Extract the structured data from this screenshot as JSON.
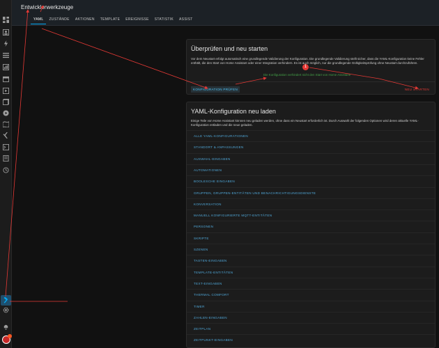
{
  "header": {
    "title": "Entwicklerwerkzeuge",
    "tabs": [
      {
        "label": "YAML",
        "active": true
      },
      {
        "label": "ZUSTÄNDE"
      },
      {
        "label": "AKTIONEN"
      },
      {
        "label": "TEMPLATE"
      },
      {
        "label": "EREIGNISSE"
      },
      {
        "label": "STATISTIK"
      },
      {
        "label": "ASSIST"
      }
    ]
  },
  "check_card": {
    "title": "Überprüfen und neu starten",
    "description": "Vor dem Neustart erfolgt automatisch eine grundlegende Validierung der Konfiguration. Die grundlegende Validierung stellt sicher, dass die YAML-Konfiguration keine Fehler enthält, die den Start von Home Assistant oder einer Integration verhindern. Es ist auch möglich, nur die grundlegende Gültigkeitsprüfung ohne Neustart durchzuführen.",
    "valid_message": "Die Konfiguration verhindert nicht den Start von Home Assistant!",
    "check_button": "KONFIGURATION PRÜFEN",
    "restart_button": "NEU STARTEN"
  },
  "annotation": {
    "marker": "1"
  },
  "reload_card": {
    "title": "YAML-Konfiguration neu laden",
    "description": "Einige Teile von Home Assistant können neu geladen werden, ohne dass ein Neustart erforderlich ist. Durch Auswahl der folgenden Optionen wird deren aktuelle YAML-Konfiguration entladen und die neue geladen.",
    "items": [
      "ALLE YAML-KONFIGURATIONEN",
      "STANDORT & ANPASSUNGEN",
      "AUSWAHL-EINGABEN",
      "AUTOMATIONEN",
      "BOOLESCHE EINGABEN",
      "GRUPPEN, GRUPPEN-ENTITÄTEN UND BENACHRICHTIGUNGSDIENSTE",
      "KONVERSATION",
      "MANUELL KONFIGURIERTE MQTT-ENTITÄTEN",
      "PERSONEN",
      "SKRIPTE",
      "SZENEN",
      "TASTEN-EINGABEN",
      "TEMPLATE-ENTITÄTEN",
      "TEXT-EINGABEN",
      "THERMAL COMFORT",
      "TIMER",
      "ZAHLEN-EINGABEN",
      "ZEITPLAN",
      "ZEITPUNKT-EINGABEN"
    ]
  },
  "sidebar": {
    "icons": [
      "dashboard-icon",
      "person-icon",
      "energy-icon",
      "list-icon",
      "chart-icon",
      "calendar-icon",
      "media-icon",
      "todo-icon",
      "play-icon",
      "map-icon",
      "vscode-icon",
      "terminal-icon",
      "logbook-icon",
      "history-icon"
    ],
    "colors": {
      "accent": "#03a9f4",
      "active_bg": "#1e4f6e"
    }
  }
}
